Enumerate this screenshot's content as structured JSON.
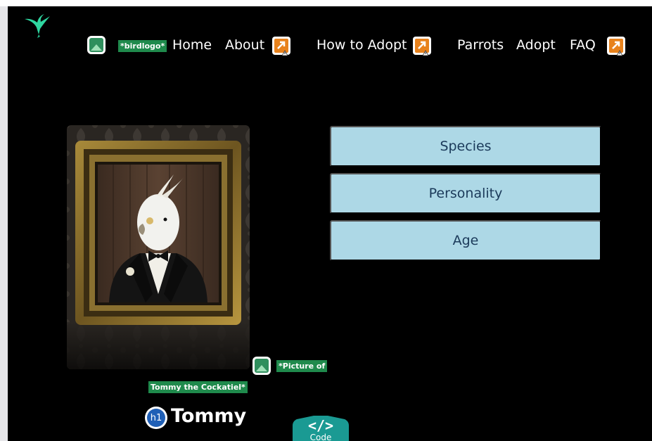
{
  "logo": {
    "icon": "hummingbird-icon",
    "color": "#2fd6a0"
  },
  "nav": {
    "logo_alt": "*birdlogo*",
    "links": [
      {
        "label": "Home"
      },
      {
        "label": "About"
      },
      {
        "label": "How to Adopt"
      },
      {
        "label": "Parrots"
      },
      {
        "label": "Adopt"
      },
      {
        "label": "FAQ"
      }
    ]
  },
  "portrait": {
    "alt_line1": "*Picture of",
    "alt_line2": "Tommy the Cockatiel*"
  },
  "accordion": [
    {
      "label": "Species"
    },
    {
      "label": "Personality"
    },
    {
      "label": "Age"
    }
  ],
  "heading": {
    "tag": "h1",
    "text": "Tommy"
  },
  "code_tab": {
    "symbol": "</>",
    "label": "Code"
  },
  "colors": {
    "page_bg": "#000000",
    "accordion_bg": "#add8e6",
    "accordion_text": "#1b3a5a",
    "alt_badge": "#1f8a4c",
    "code_tab": "#1a9a93",
    "ext_icon": "#e8821c"
  }
}
